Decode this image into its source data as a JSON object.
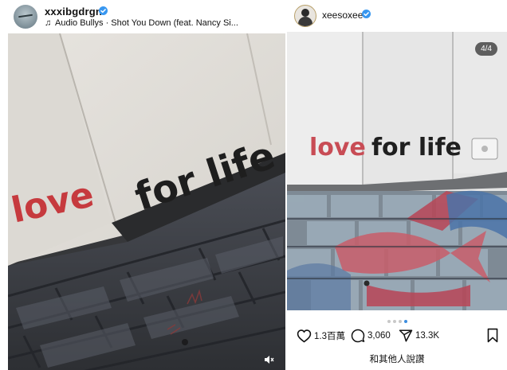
{
  "left_post": {
    "username": "xxxibgdrgn",
    "audio": "Audio Bullys · Shot You Down (feat. Nancy Si...",
    "photo_text_love": "love",
    "photo_text_forlife": "for life",
    "icons": {
      "avatar": "avatar",
      "verified": "verified-icon",
      "music": "music-note-icon",
      "mute": "mute-icon"
    }
  },
  "right_post": {
    "username": "xeesoxee",
    "page_counter": "4/4",
    "photo_text_love": "love",
    "photo_text_forlife": "for life",
    "likes": "1.3百萬",
    "comments": "3,060",
    "shares": "13.3K",
    "liked_by": "和其他人說讚",
    "dots": 4,
    "active_dot": 4,
    "colors": {
      "verified": "#3897f0",
      "active_dot": "#3c8ddf"
    }
  }
}
